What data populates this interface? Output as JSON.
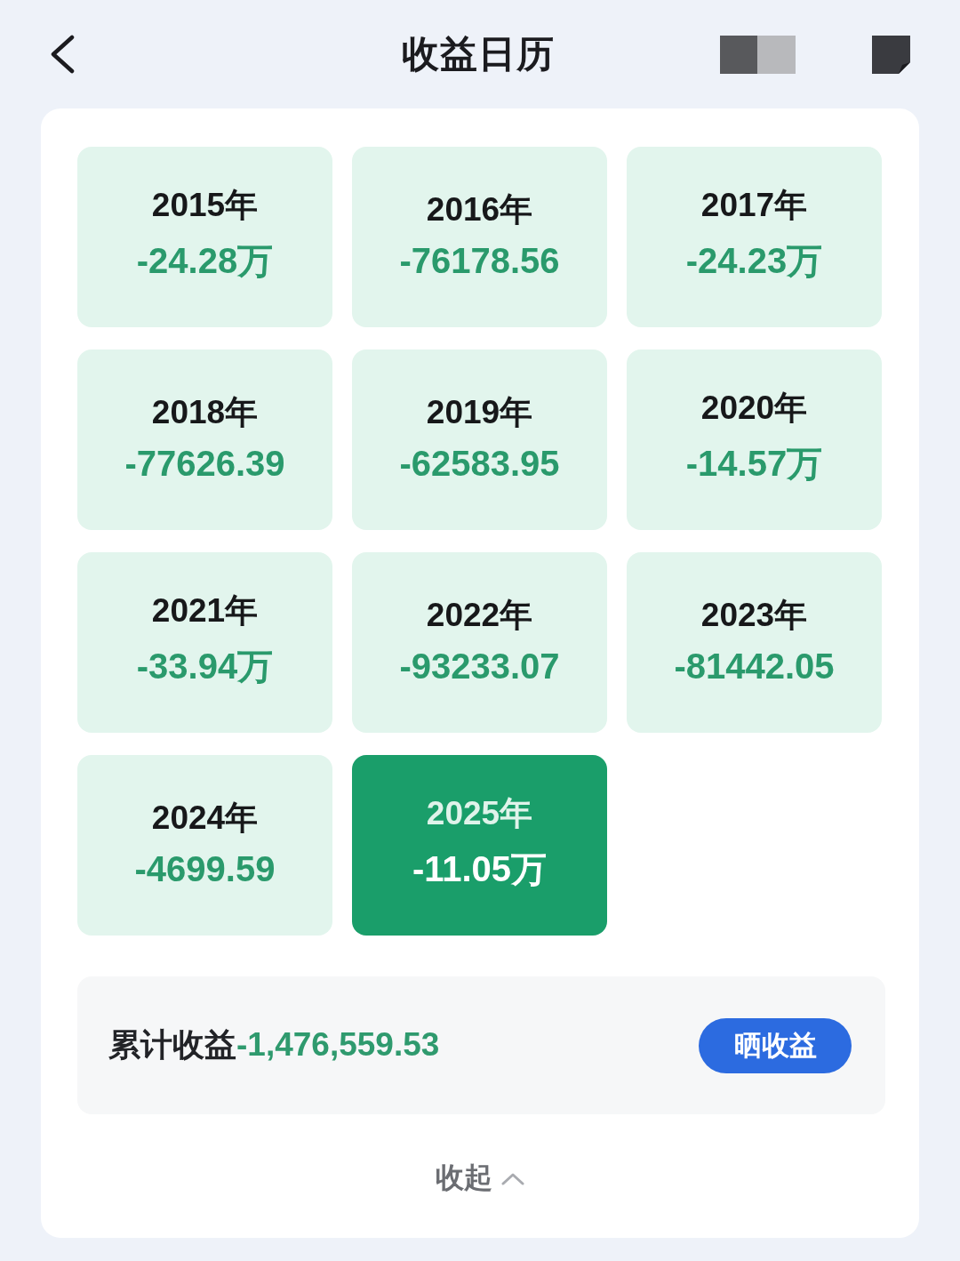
{
  "header": {
    "title": "收益日历"
  },
  "years": [
    {
      "year": "2015年",
      "value": "-24.28万",
      "selected": false
    },
    {
      "year": "2016年",
      "value": "-76178.56",
      "selected": false
    },
    {
      "year": "2017年",
      "value": "-24.23万",
      "selected": false
    },
    {
      "year": "2018年",
      "value": "-77626.39",
      "selected": false
    },
    {
      "year": "2019年",
      "value": "-62583.95",
      "selected": false
    },
    {
      "year": "2020年",
      "value": "-14.57万",
      "selected": false
    },
    {
      "year": "2021年",
      "value": "-33.94万",
      "selected": false
    },
    {
      "year": "2022年",
      "value": "-93233.07",
      "selected": false
    },
    {
      "year": "2023年",
      "value": "-81442.05",
      "selected": false
    },
    {
      "year": "2024年",
      "value": "-4699.59",
      "selected": false
    },
    {
      "year": "2025年",
      "value": "-11.05万",
      "selected": true
    }
  ],
  "summary": {
    "label": "累计收益",
    "value": "-1,476,559.53",
    "button": "晒收益"
  },
  "collapse": {
    "label": "收起"
  }
}
